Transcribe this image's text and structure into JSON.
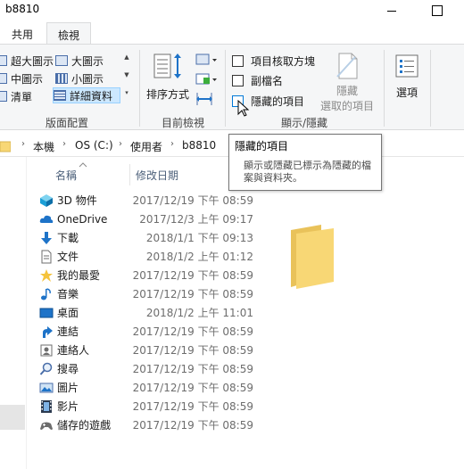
{
  "window": {
    "title": "b8810"
  },
  "tabs": {
    "share": "共用",
    "view": "檢視"
  },
  "ribbon": {
    "layout": {
      "items": {
        "extra_large": "超大圖示",
        "large": "大圖示",
        "medium": "中圖示",
        "small": "小圖示",
        "list": "清單",
        "details": "詳細資料"
      },
      "group_label": "版面配置"
    },
    "current_view": {
      "sort_label": "排序方式",
      "group_label": "目前檢視"
    },
    "show_hide": {
      "item_checkboxes": "項目核取方塊",
      "file_extensions": "副檔名",
      "hidden_items": "隱藏的項目",
      "hide_selected_line1": "隱藏",
      "hide_selected_line2": "選取的項目",
      "group_label": "顯示/隱藏"
    },
    "options_label": "選項"
  },
  "breadcrumb": [
    "本機",
    "OS (C:)",
    "使用者",
    "b8810"
  ],
  "tooltip": {
    "title": "隱藏的項目",
    "body": "顯示或隱藏已標示為隱藏的檔案與資料夾。"
  },
  "columns": {
    "name": "名稱",
    "date": "修改日期"
  },
  "files": [
    {
      "name": "3D 物件",
      "date": "2017/12/19 下午 08:59",
      "icon": "cube-3d-icon"
    },
    {
      "name": "OneDrive",
      "date": "2017/12/3 上午 09:17",
      "icon": "cloud-icon"
    },
    {
      "name": "下載",
      "date": "2018/1/1 下午 09:13",
      "icon": "download-arrow-icon"
    },
    {
      "name": "文件",
      "date": "2018/1/2 上午 01:12",
      "icon": "document-icon"
    },
    {
      "name": "我的最愛",
      "date": "2017/12/19 下午 08:59",
      "icon": "star-icon"
    },
    {
      "name": "音樂",
      "date": "2017/12/19 下午 08:59",
      "icon": "music-note-icon"
    },
    {
      "name": "桌面",
      "date": "2018/1/2 上午 11:01",
      "icon": "desktop-icon"
    },
    {
      "name": "連結",
      "date": "2017/12/19 下午 08:59",
      "icon": "link-arrow-icon"
    },
    {
      "name": "連絡人",
      "date": "2017/12/19 下午 08:59",
      "icon": "contacts-icon"
    },
    {
      "name": "搜尋",
      "date": "2017/12/19 下午 08:59",
      "icon": "search-icon"
    },
    {
      "name": "圖片",
      "date": "2017/12/19 下午 08:59",
      "icon": "picture-icon"
    },
    {
      "name": "影片",
      "date": "2017/12/19 下午 08:59",
      "icon": "film-icon"
    },
    {
      "name": "儲存的遊戲",
      "date": "2017/12/19 下午 08:59",
      "icon": "game-controller-icon"
    }
  ],
  "colors": {
    "accent": "#0078d7",
    "folder": "#f8d775",
    "selection": "#cce8ff"
  }
}
